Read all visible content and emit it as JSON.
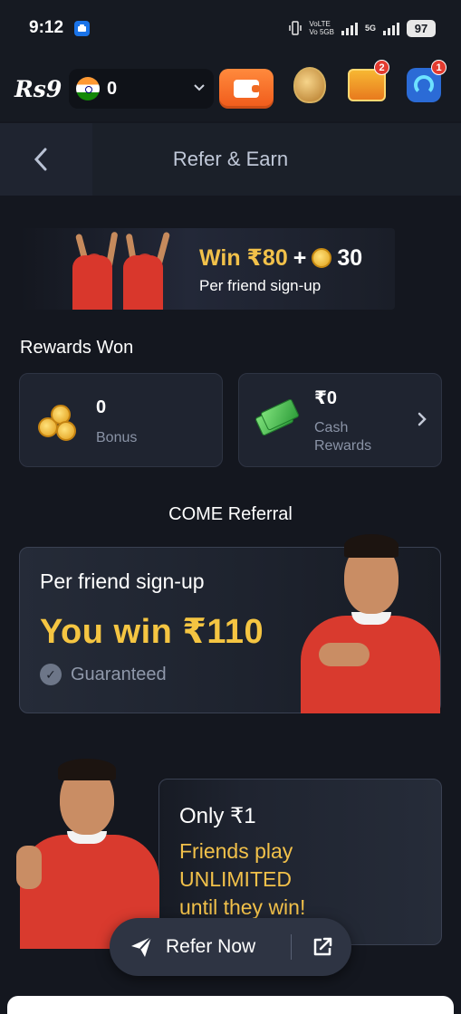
{
  "status_bar": {
    "time": "9:12",
    "network_label_top": "VoLTE",
    "network_label_bottom": "Vo 5GB",
    "signal_label": "5G",
    "battery": "97"
  },
  "header": {
    "logo": "Rs9",
    "balance": "0",
    "treasure_badge": "2",
    "support_badge": "1"
  },
  "page": {
    "title": "Refer & Earn"
  },
  "promo": {
    "win_amount": "Win ₹80",
    "plus": "+",
    "coins": "30",
    "subtitle": "Per friend sign-up"
  },
  "rewards": {
    "title": "Rewards Won",
    "bonus_value": "0",
    "bonus_label": "Bonus",
    "cash_value": "₹0",
    "cash_label_line1": "Cash",
    "cash_label_line2": "Rewards"
  },
  "come_referral": {
    "title": "COME Referral",
    "subtitle": "Per friend sign-up",
    "win_text": "You win ₹110",
    "guaranteed": "Guaranteed"
  },
  "only_card": {
    "title": "Only ₹1",
    "desc_line1": "Friends play",
    "desc_line2": "UNLIMITED",
    "desc_line3": "until they win!"
  },
  "refer_button": {
    "label": "Refer Now"
  },
  "colors": {
    "background": "#14171f",
    "accent_gold": "#f5c542",
    "wallet_orange": "#f06a22",
    "card_bg": "#1f2430",
    "jersey_red": "#d93a2e"
  },
  "icons": [
    "back-icon",
    "wallet-icon",
    "jar-icon",
    "treasure-chest-icon",
    "support-icon",
    "coins-icon",
    "cash-icon",
    "chevron-right-icon",
    "check-badge-icon",
    "send-icon",
    "share-icon"
  ]
}
